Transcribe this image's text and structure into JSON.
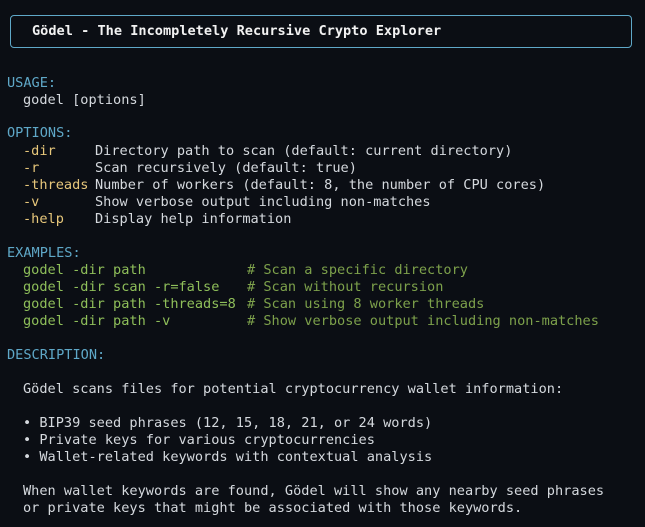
{
  "banner": {
    "title": "Gödel - The Incompletely Recursive Crypto Explorer"
  },
  "usage": {
    "heading": "USAGE:",
    "command": "godel [options]"
  },
  "options": {
    "heading": "OPTIONS:",
    "items": [
      {
        "flag": "-dir",
        "desc": "Directory path to scan (default: current directory)"
      },
      {
        "flag": "-r",
        "desc": "Scan recursively (default: true)"
      },
      {
        "flag": "-threads",
        "desc": "Number of workers (default: 8, the number of CPU cores)"
      },
      {
        "flag": "-v",
        "desc": "Show verbose output including non-matches"
      },
      {
        "flag": "-help",
        "desc": "Display help information"
      }
    ]
  },
  "examples": {
    "heading": "EXAMPLES:",
    "items": [
      {
        "cmd": "godel -dir path",
        "comment": "# Scan a specific directory"
      },
      {
        "cmd": "godel -dir scan -r=false",
        "comment": "# Scan without recursion"
      },
      {
        "cmd": "godel -dir path -threads=8",
        "comment": "# Scan using 8 worker threads"
      },
      {
        "cmd": "godel -dir path -v",
        "comment": "# Show verbose output including non-matches"
      }
    ]
  },
  "description": {
    "heading": "DESCRIPTION:",
    "intro": "Gödel scans files for potential cryptocurrency wallet information:",
    "bullets": [
      "• BIP39 seed phrases (12, 15, 18, 21, or 24 words)",
      "• Private keys for various cryptocurrencies",
      "• Wallet-related keywords with contextual analysis"
    ],
    "outro_lines": [
      "When wallet keywords are found, Gödel will show any nearby seed phrases",
      "or private keys that might be associated with those keywords."
    ]
  }
}
